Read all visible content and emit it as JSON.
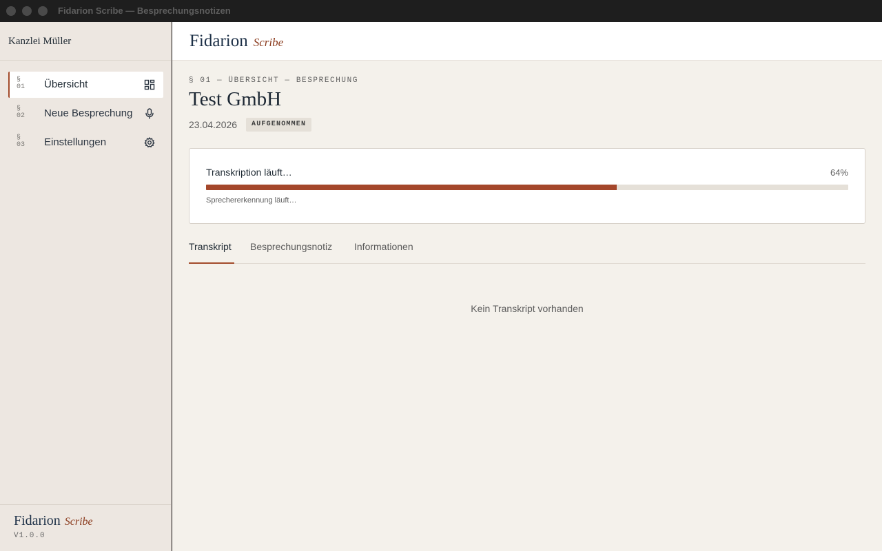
{
  "window": {
    "title": "Fidarion Scribe — Besprechungsnotizen"
  },
  "sidebar": {
    "firm": "Kanzlei Müller",
    "items": [
      {
        "num": "§\n01",
        "label": "Übersicht",
        "icon": "dashboard-icon",
        "active": true
      },
      {
        "num": "§\n02",
        "label": "Neue Besprechung",
        "icon": "microphone-icon",
        "active": false
      },
      {
        "num": "§\n03",
        "label": "Einstellungen",
        "icon": "gear-icon",
        "active": false
      }
    ],
    "brand_name": "Fidarion",
    "brand_sub": "Scribe",
    "version": "V1.0.0"
  },
  "header": {
    "brand_name": "Fidarion",
    "brand_sub": "Scribe"
  },
  "main": {
    "kicker": "§ 01 — ÜBERSICHT — BESPRECHUNG",
    "title": "Test GmbH",
    "date": "23.04.2026",
    "status_badge": "AUFGENOMMEN",
    "progress": {
      "label": "Transkription läuft…",
      "percent_text": "64%",
      "value": 0.64,
      "sub": "Sprechererkennung läuft…"
    },
    "tabs": [
      {
        "label": "Transkript",
        "active": true
      },
      {
        "label": "Besprechungsnotiz",
        "active": false
      },
      {
        "label": "Informationen",
        "active": false
      }
    ],
    "empty_state": "Kein Transkript vorhanden"
  },
  "colors": {
    "accent": "#a4472b",
    "sidebar_bg": "#ede7e1",
    "main_bg": "#f4f1eb",
    "brand_navy": "#1d3047"
  }
}
